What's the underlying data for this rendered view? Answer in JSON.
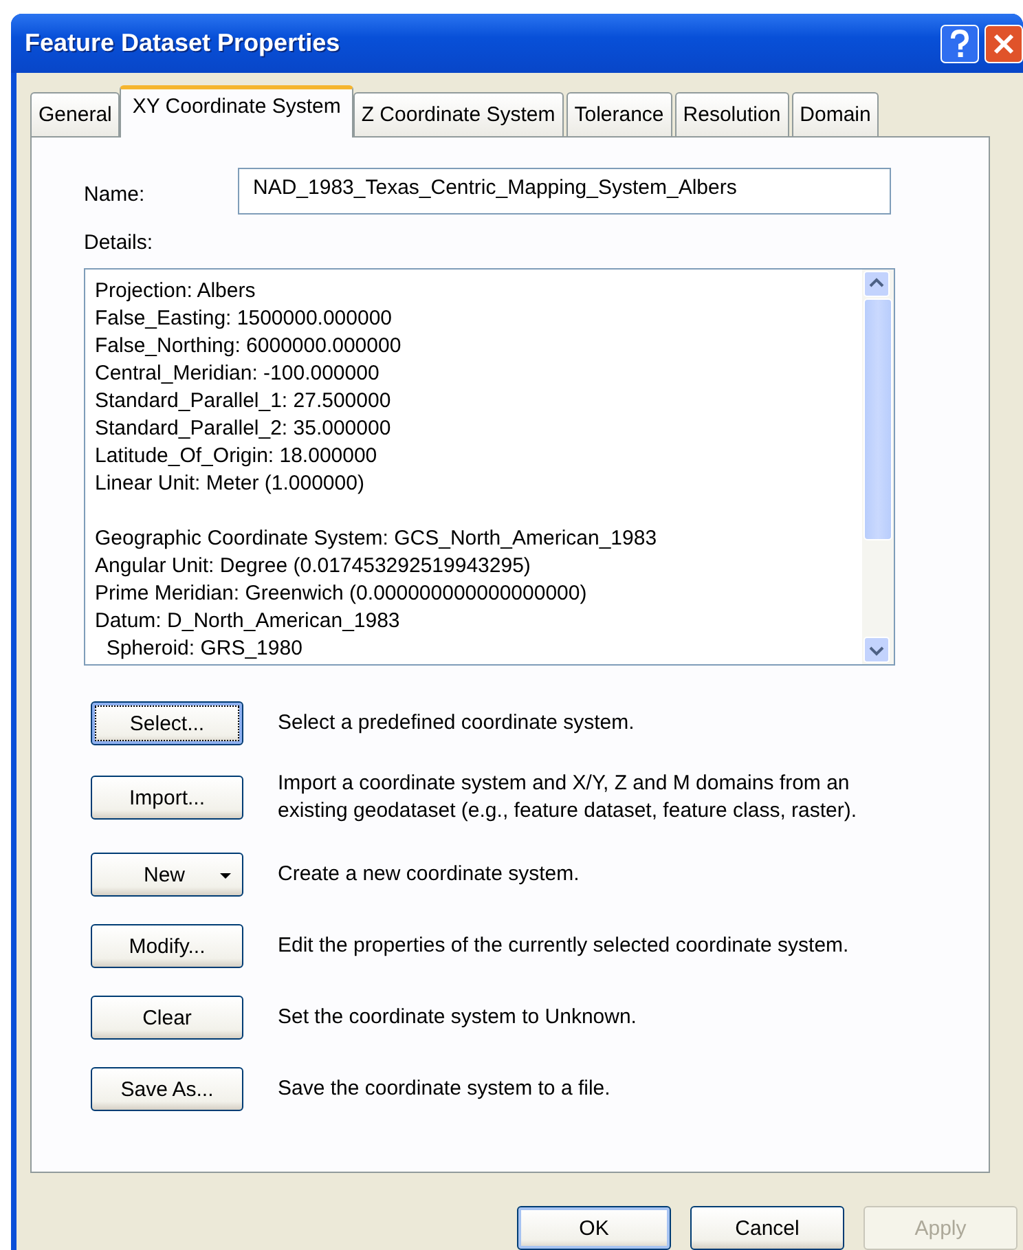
{
  "window": {
    "title": "Feature Dataset Properties"
  },
  "tabs": [
    {
      "label": "General",
      "selected": false
    },
    {
      "label": "XY Coordinate System",
      "selected": true
    },
    {
      "label": "Z Coordinate System",
      "selected": false
    },
    {
      "label": "Tolerance",
      "selected": false
    },
    {
      "label": "Resolution",
      "selected": false
    },
    {
      "label": "Domain",
      "selected": false
    }
  ],
  "name_field": {
    "label": "Name:",
    "value": "NAD_1983_Texas_Centric_Mapping_System_Albers"
  },
  "details": {
    "label": "Details:",
    "paragraphs": [
      [
        "Projection: Albers",
        "False_Easting: 1500000.000000",
        "False_Northing: 6000000.000000",
        "Central_Meridian: -100.000000",
        "Standard_Parallel_1: 27.500000",
        "Standard_Parallel_2: 35.000000",
        "Latitude_Of_Origin: 18.000000",
        "Linear Unit: Meter (1.000000)"
      ],
      [
        "Geographic Coordinate System: GCS_North_American_1983",
        "Angular Unit: Degree (0.017453292519943295)",
        "Prime Meridian: Greenwich (0.000000000000000000)",
        "Datum: D_North_American_1983",
        "  Spheroid: GRS_1980"
      ]
    ]
  },
  "actions": [
    {
      "label": "Select...",
      "kind": "plain",
      "focused": true,
      "description": "Select a predefined coordinate system."
    },
    {
      "label": "Import...",
      "kind": "plain",
      "focused": false,
      "description": "Import a coordinate system and X/Y, Z and M domains from an existing geodataset (e.g., feature dataset, feature class, raster)."
    },
    {
      "label": "New",
      "kind": "dropdown",
      "focused": false,
      "description": "Create a new coordinate system."
    },
    {
      "label": "Modify...",
      "kind": "plain",
      "focused": false,
      "description": "Edit the properties of the currently selected coordinate system."
    },
    {
      "label": "Clear",
      "kind": "plain",
      "focused": false,
      "description": "Set the coordinate system to Unknown."
    },
    {
      "label": "Save As...",
      "kind": "plain",
      "focused": false,
      "description": "Save the coordinate system to a file."
    }
  ],
  "buttons": [
    {
      "label": "OK",
      "default": true,
      "disabled": false
    },
    {
      "label": "Cancel",
      "default": false,
      "disabled": false
    },
    {
      "label": "Apply",
      "default": false,
      "disabled": true
    }
  ]
}
